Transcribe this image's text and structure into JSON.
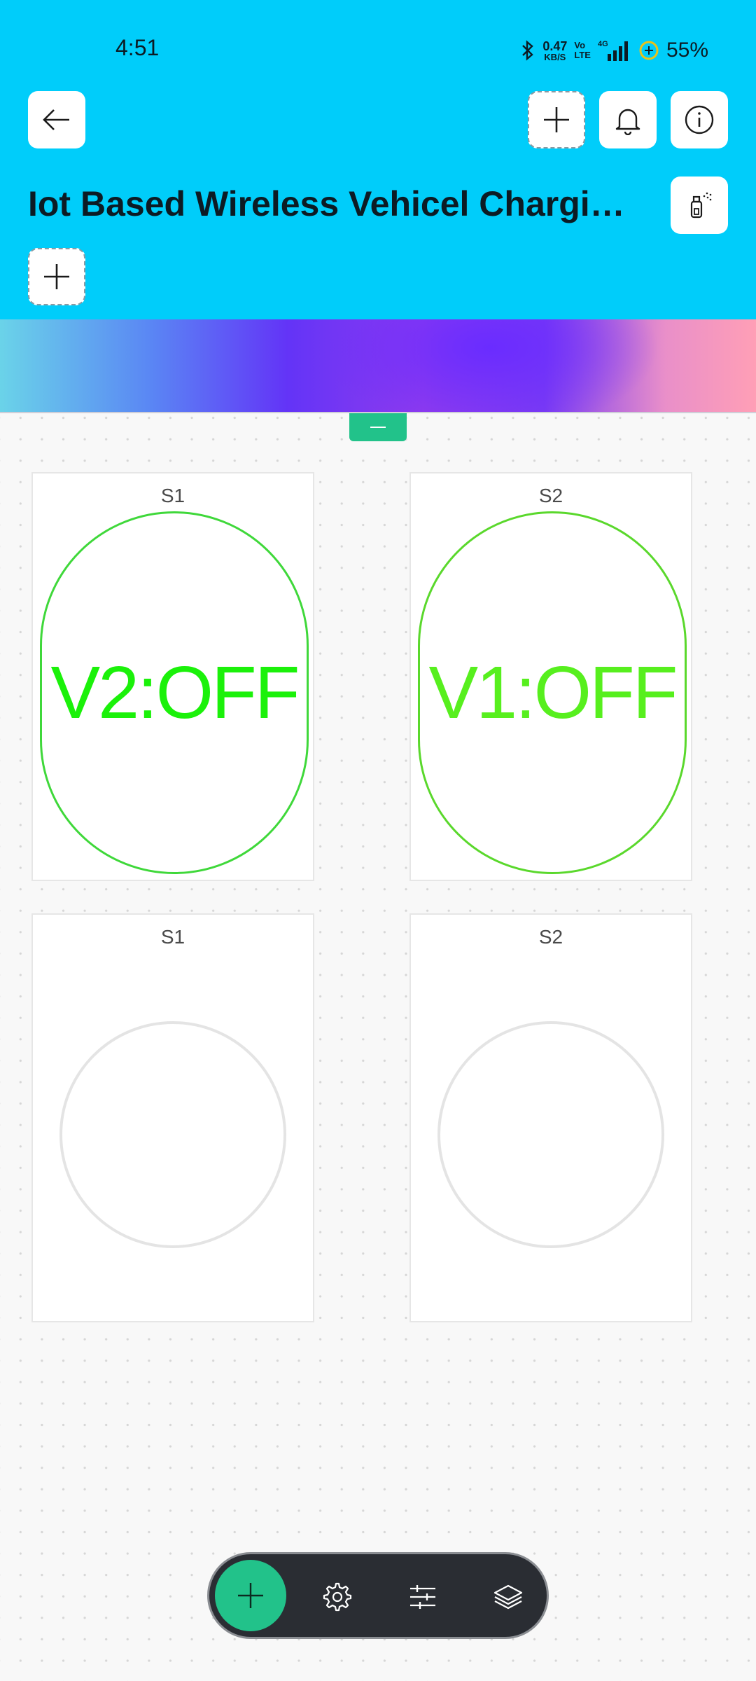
{
  "status_bar": {
    "time": "4:51",
    "net_speed_value": "0.47",
    "net_speed_unit": "KB/S",
    "volte_top": "Vo",
    "volte_bottom": "LTE",
    "network": "4G",
    "battery": "55%"
  },
  "header": {
    "title": "Iot Based Wireless Vehicel Charging Station",
    "background_color": "#00cdfa"
  },
  "widgets": [
    {
      "title": "S1",
      "type": "led-label",
      "text": "V2:OFF",
      "color": "#1bf10a"
    },
    {
      "title": "S2",
      "type": "led-label",
      "text": "V1:OFF",
      "color": "#57ef1e"
    },
    {
      "title": "S1",
      "type": "led",
      "state": "off"
    },
    {
      "title": "S2",
      "type": "led",
      "state": "off"
    }
  ],
  "toolbar": {
    "items": [
      "add",
      "settings",
      "filters",
      "layers"
    ],
    "accent_color": "#22c28a"
  }
}
